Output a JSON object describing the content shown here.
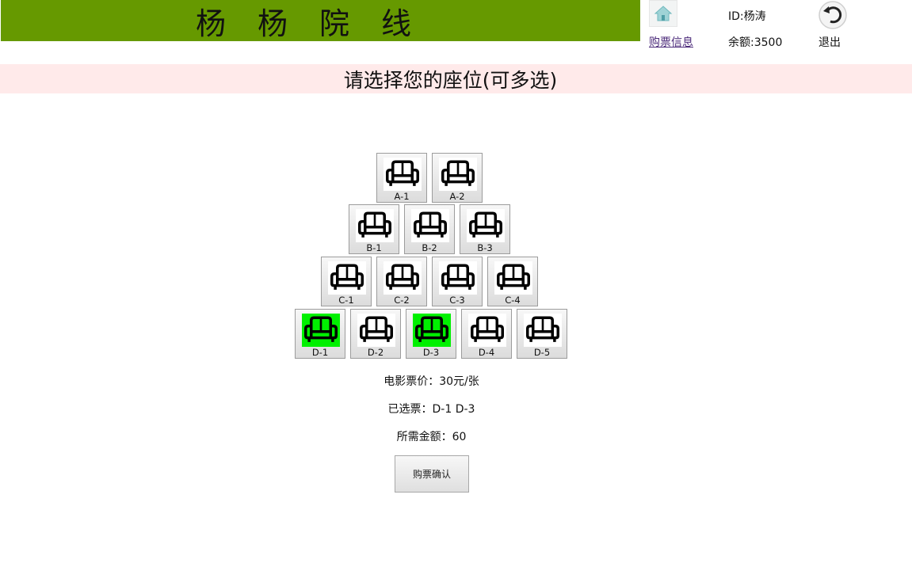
{
  "header": {
    "title_chars": [
      "杨",
      "杨",
      "院",
      "线"
    ],
    "banner_color": "#669900",
    "home_icon": "home-icon",
    "ticket_info_link": "购票信息",
    "user_id": "ID:杨涛",
    "balance": "余额:3500",
    "logout_icon": "undo-arrow-icon",
    "logout_label": "退出"
  },
  "instruction": {
    "text": "请选择您的座位(可多选)",
    "bg_color": "#ffeaea"
  },
  "seats": {
    "icon": "armchair-icon",
    "selected_color": "#00f000",
    "rows": [
      {
        "row": "A",
        "seats": [
          {
            "label": "A-1",
            "selected": false
          },
          {
            "label": "A-2",
            "selected": false
          }
        ]
      },
      {
        "row": "B",
        "seats": [
          {
            "label": "B-1",
            "selected": false
          },
          {
            "label": "B-2",
            "selected": false
          },
          {
            "label": "B-3",
            "selected": false
          }
        ]
      },
      {
        "row": "C",
        "seats": [
          {
            "label": "C-1",
            "selected": false
          },
          {
            "label": "C-2",
            "selected": false
          },
          {
            "label": "C-3",
            "selected": false
          },
          {
            "label": "C-4",
            "selected": false
          }
        ]
      },
      {
        "row": "D",
        "seats": [
          {
            "label": "D-1",
            "selected": true
          },
          {
            "label": "D-2",
            "selected": false
          },
          {
            "label": "D-3",
            "selected": true
          },
          {
            "label": "D-4",
            "selected": false
          },
          {
            "label": "D-5",
            "selected": false
          }
        ]
      }
    ]
  },
  "summary": {
    "price": "电影票价：30元/张",
    "selected": "已选票：D-1 D-3",
    "total": "所需金额：60",
    "confirm_button": "购票确认"
  }
}
